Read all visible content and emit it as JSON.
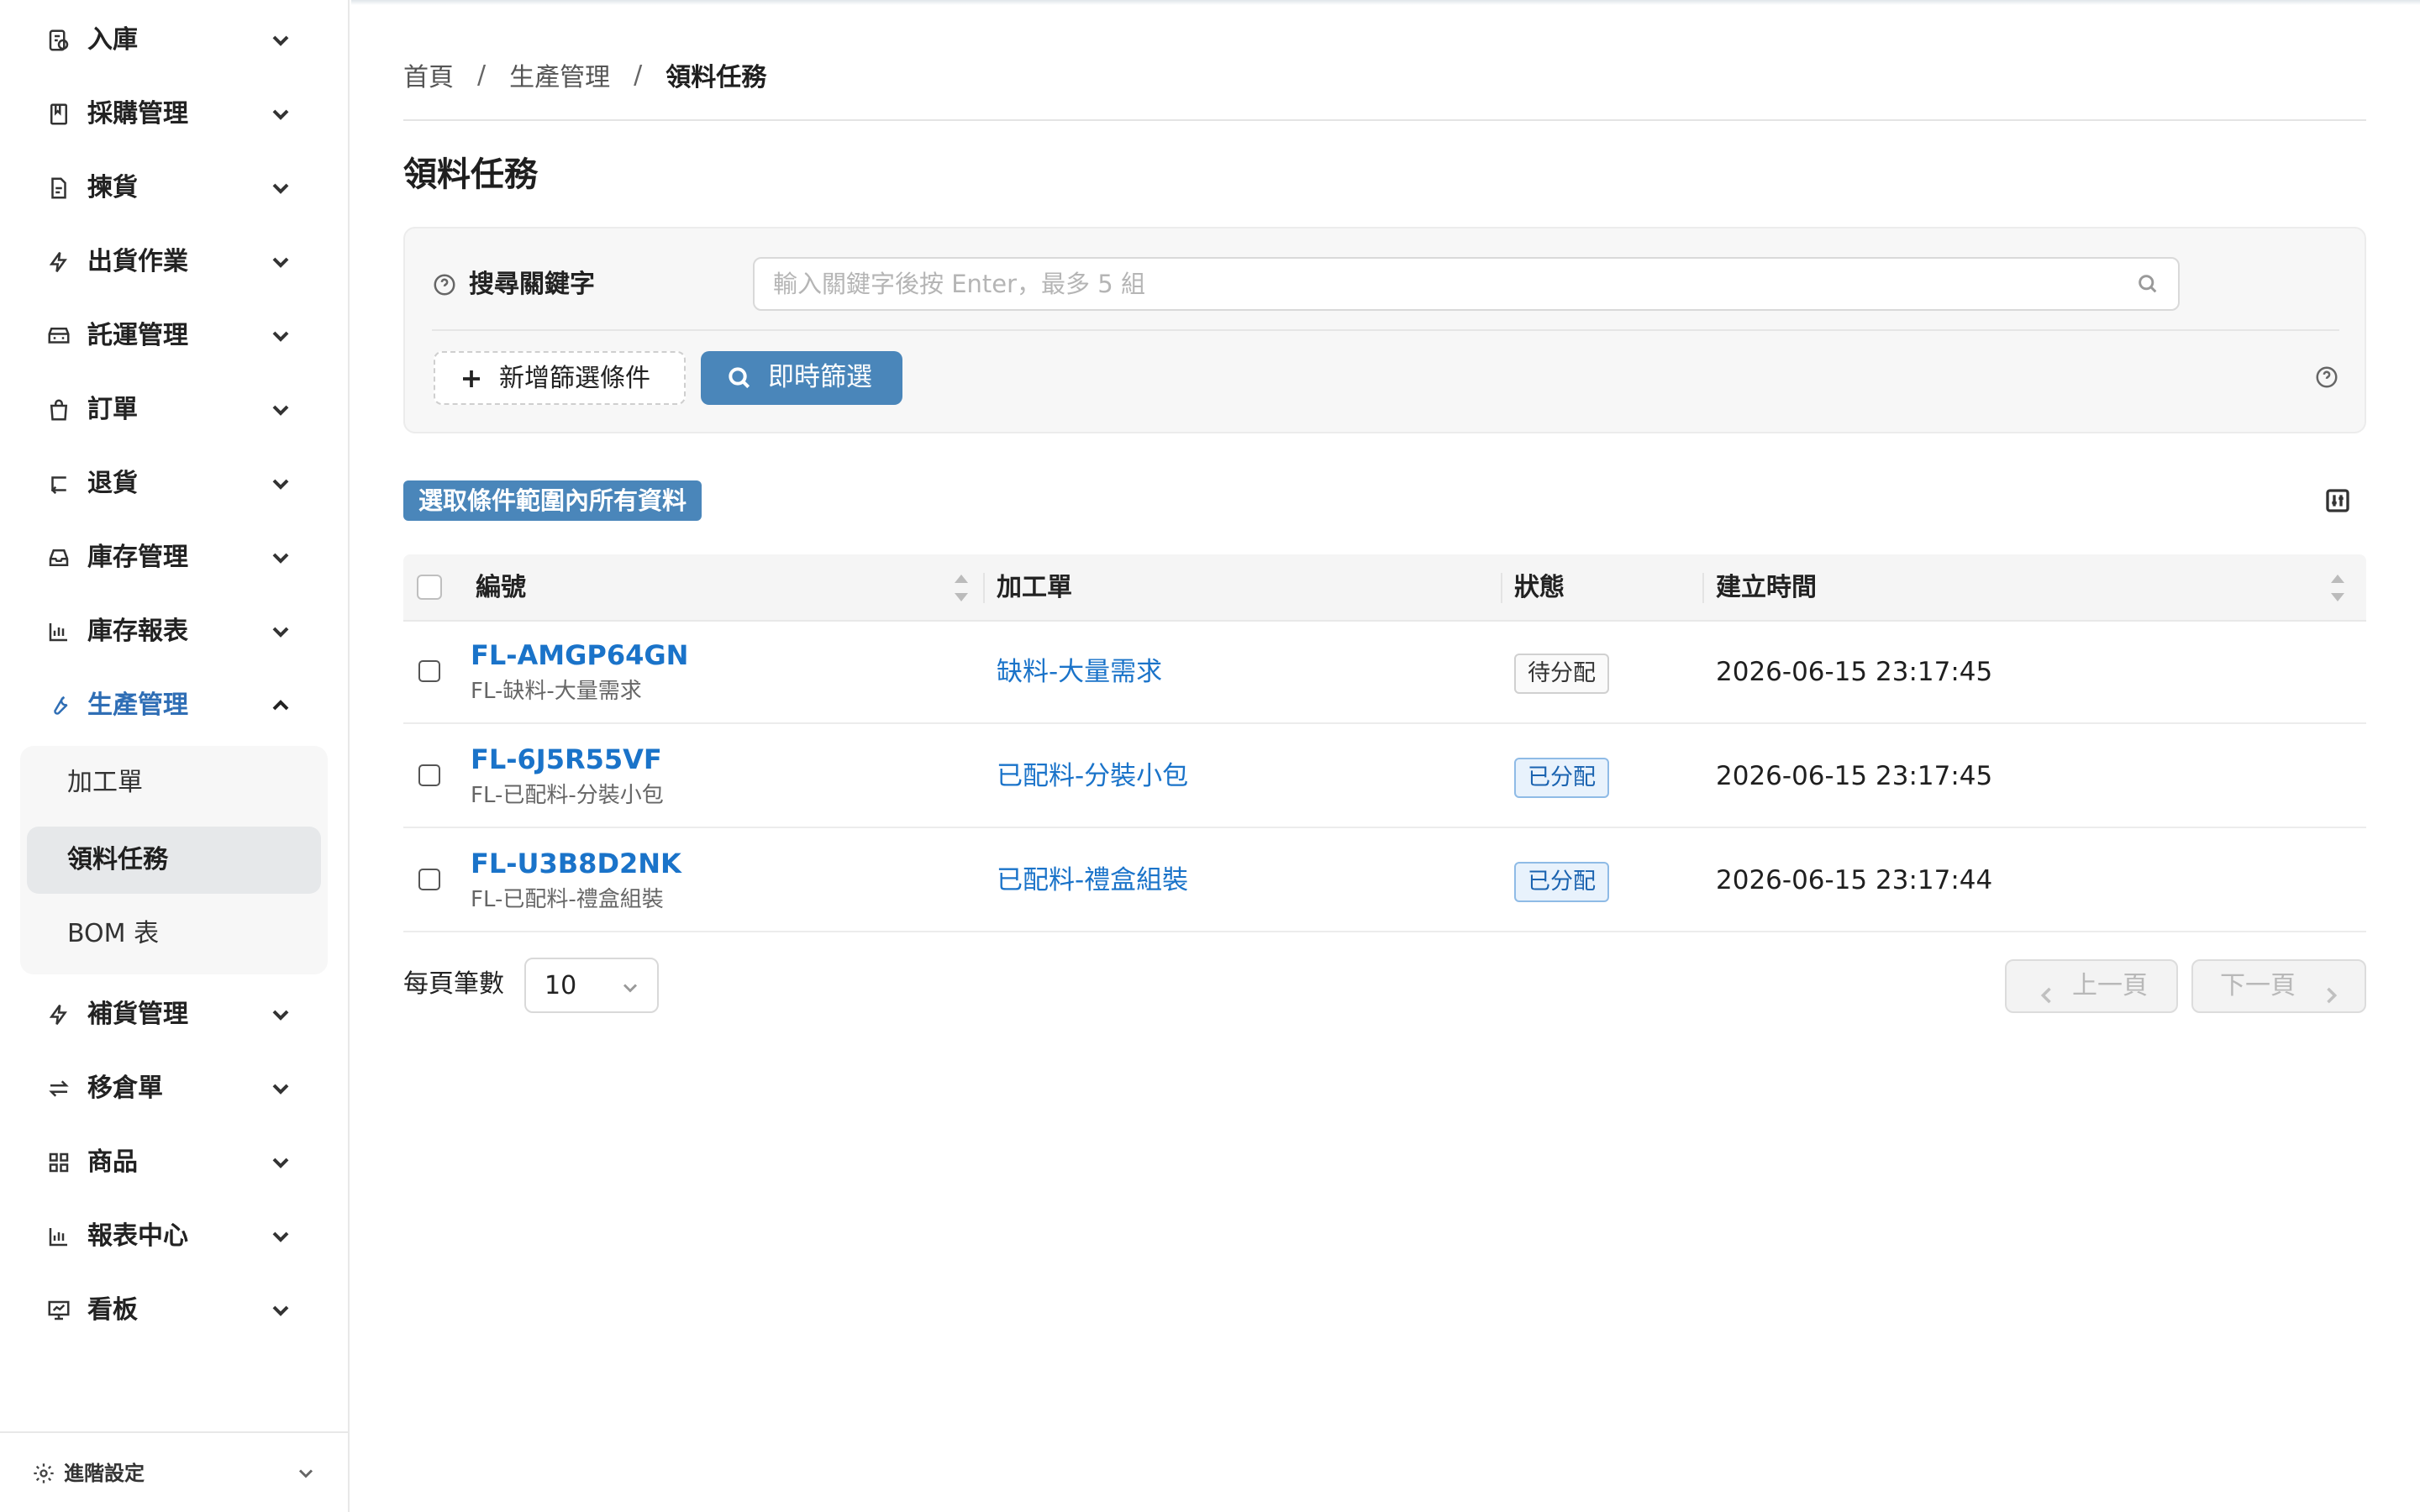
{
  "sidebar": {
    "items": [
      {
        "label": "入庫",
        "icon": "inbound-icon"
      },
      {
        "label": "採購管理",
        "icon": "book-icon"
      },
      {
        "label": "揀貨",
        "icon": "document-icon"
      },
      {
        "label": "出貨作業",
        "icon": "lightning-icon"
      },
      {
        "label": "託運管理",
        "icon": "truck-icon"
      },
      {
        "label": "訂單",
        "icon": "shopping-bag-icon"
      },
      {
        "label": "退貨",
        "icon": "return-icon"
      },
      {
        "label": "庫存管理",
        "icon": "inbox-icon"
      },
      {
        "label": "庫存報表",
        "icon": "bar-chart-icon"
      },
      {
        "label": "生產管理",
        "icon": "wrench-icon"
      },
      {
        "label": "補貨管理",
        "icon": "lightning-icon"
      },
      {
        "label": "移倉單",
        "icon": "swap-icon"
      },
      {
        "label": "商品",
        "icon": "grid-icon"
      },
      {
        "label": "報表中心",
        "icon": "bar-chart-icon"
      },
      {
        "label": "看板",
        "icon": "dashboard-icon"
      }
    ],
    "active_item": "生產管理",
    "submenu": [
      "加工單",
      "領料任務",
      "BOM 表"
    ],
    "active_subitem": "領料任務",
    "advanced_settings": "進階設定"
  },
  "breadcrumb": {
    "home": "首頁",
    "section": "生產管理",
    "current": "領料任務",
    "separator": "/"
  },
  "page": {
    "title": "領料任務"
  },
  "filter": {
    "keyword_label": "搜尋關鍵字",
    "keyword_placeholder": "輸入關鍵字後按 Enter，最多 5 組",
    "keyword_value": "",
    "add_filter": "新增篩選條件",
    "instant_filter": "即時篩選"
  },
  "toolbar": {
    "select_all_in_range": "選取條件範圍內所有資料"
  },
  "table": {
    "columns": [
      "編號",
      "加工單",
      "狀態",
      "建立時間"
    ],
    "rows": [
      {
        "id": "FL-AMGP64GN",
        "sub": "FL-缺料-大量需求",
        "order": "缺料-大量需求",
        "status": "待分配",
        "created": "2026-06-15 23:17:45"
      },
      {
        "id": "FL-6J5R55VF",
        "sub": "FL-已配料-分裝小包",
        "order": "已配料-分裝小包",
        "status": "已分配",
        "created": "2026-06-15 23:17:45"
      },
      {
        "id": "FL-U3B8D2NK",
        "sub": "FL-已配料-禮盒組裝",
        "order": "已配料-禮盒組裝",
        "status": "已分配",
        "created": "2026-06-15 23:17:44"
      }
    ]
  },
  "pagination": {
    "page_size_label": "每頁筆數",
    "page_size": "10",
    "prev": "上一頁",
    "next": "下一頁"
  },
  "colors": {
    "accent": "#4a86ba",
    "link": "#1a73c9",
    "active_menu": "#2f6eb5"
  }
}
